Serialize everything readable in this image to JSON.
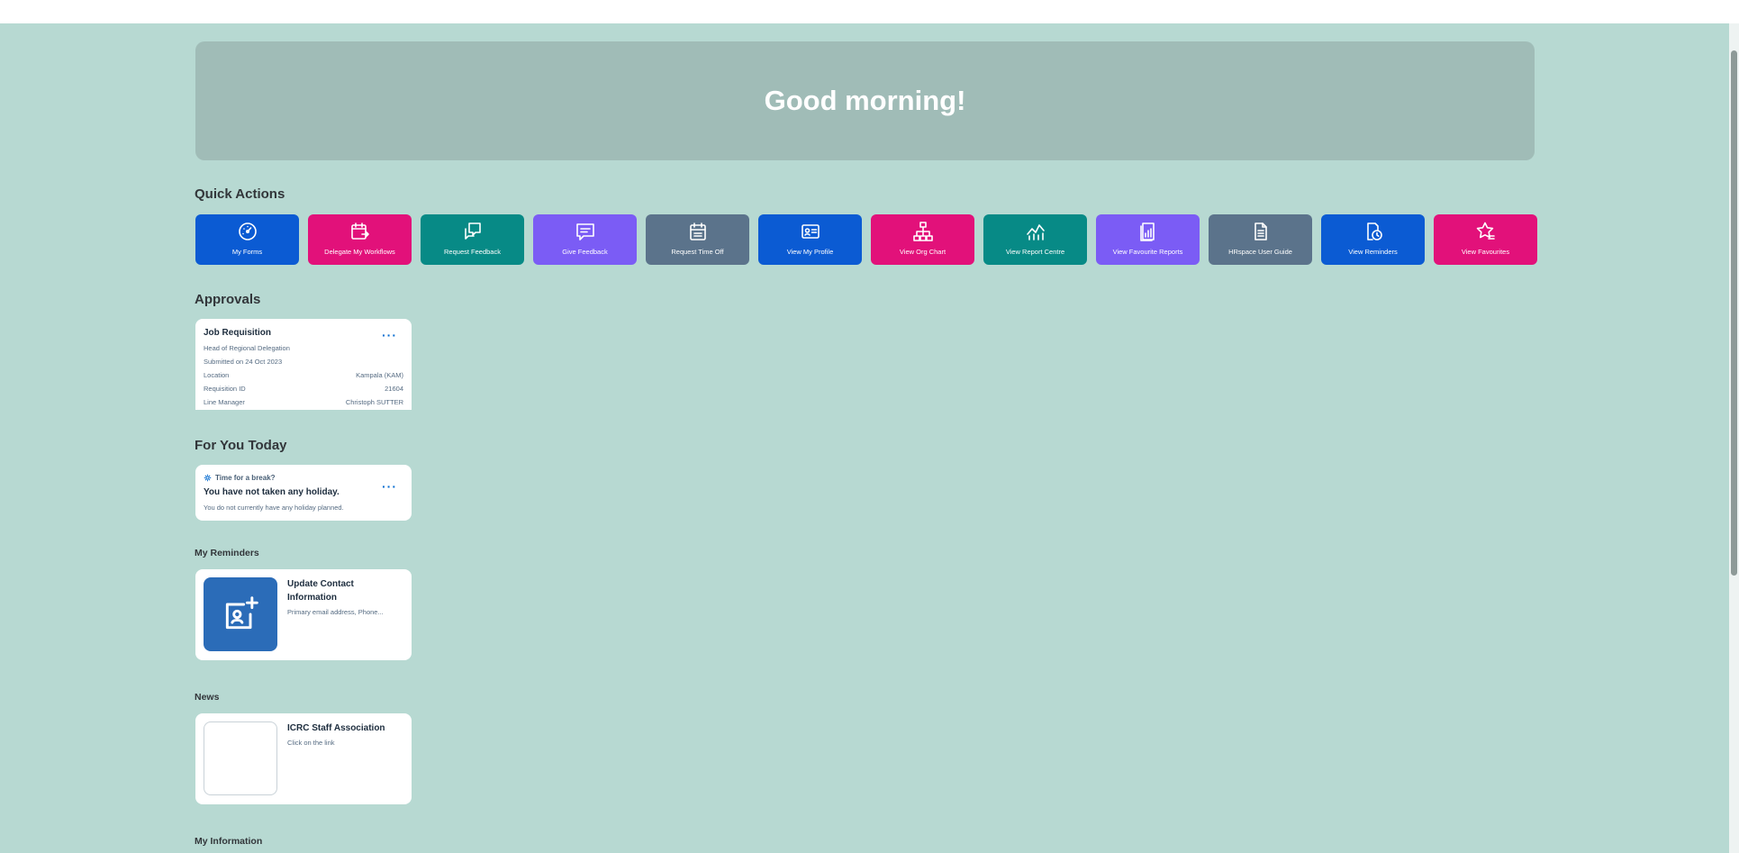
{
  "hero": {
    "greeting": "Good morning!"
  },
  "sections": {
    "quick_actions": "Quick Actions",
    "approvals": "Approvals",
    "for_you_today": "For You Today",
    "my_reminders": "My Reminders",
    "news": "News",
    "my_information": "My Information"
  },
  "quick_actions": [
    {
      "label": "My Forms",
      "icon": "gauge-icon",
      "color": "#0b5bd3"
    },
    {
      "label": "Delegate My Workflows",
      "icon": "calendar-delegate-icon",
      "color": "#e2117a"
    },
    {
      "label": "Request Feedback",
      "icon": "feedback-request-icon",
      "color": "#078a86"
    },
    {
      "label": "Give Feedback",
      "icon": "feedback-give-icon",
      "color": "#7b5cf5"
    },
    {
      "label": "Request Time Off",
      "icon": "calendar-icon",
      "color": "#5b738b"
    },
    {
      "label": "View My Profile",
      "icon": "profile-card-icon",
      "color": "#0b5bd3"
    },
    {
      "label": "View Org Chart",
      "icon": "org-chart-icon",
      "color": "#e2117a"
    },
    {
      "label": "View Report Centre",
      "icon": "line-chart-icon",
      "color": "#078a86"
    },
    {
      "label": "View Favourite Reports",
      "icon": "report-icon",
      "color": "#7b5cf5"
    },
    {
      "label": "HRspace User Guide",
      "icon": "document-icon",
      "color": "#5b738b"
    },
    {
      "label": "View Reminders",
      "icon": "reminder-icon",
      "color": "#0b5bd3"
    },
    {
      "label": "View Favourites",
      "icon": "star-list-icon",
      "color": "#e2117a"
    }
  ],
  "approval_card": {
    "title": "Job Requisition",
    "subtitle": "Head of Regional Delegation",
    "submitted": "Submitted on 24 Oct 2023",
    "fields": [
      {
        "label": "Location",
        "value": "Kampala (KAM)"
      },
      {
        "label": "Requisition ID",
        "value": "21604"
      },
      {
        "label": "Line Manager",
        "value": "Christoph SUTTER"
      }
    ]
  },
  "for_you_card": {
    "header": "Time for a break?",
    "title": "You have not taken any holiday.",
    "description": "You do not currently have any holiday planned."
  },
  "reminder_card": {
    "title": "Update Contact Information",
    "description": "Primary email address, Phone...",
    "tile_color": "#2b6cb8"
  },
  "news_card": {
    "title": "ICRC Staff Association",
    "description": "Click on the link"
  }
}
